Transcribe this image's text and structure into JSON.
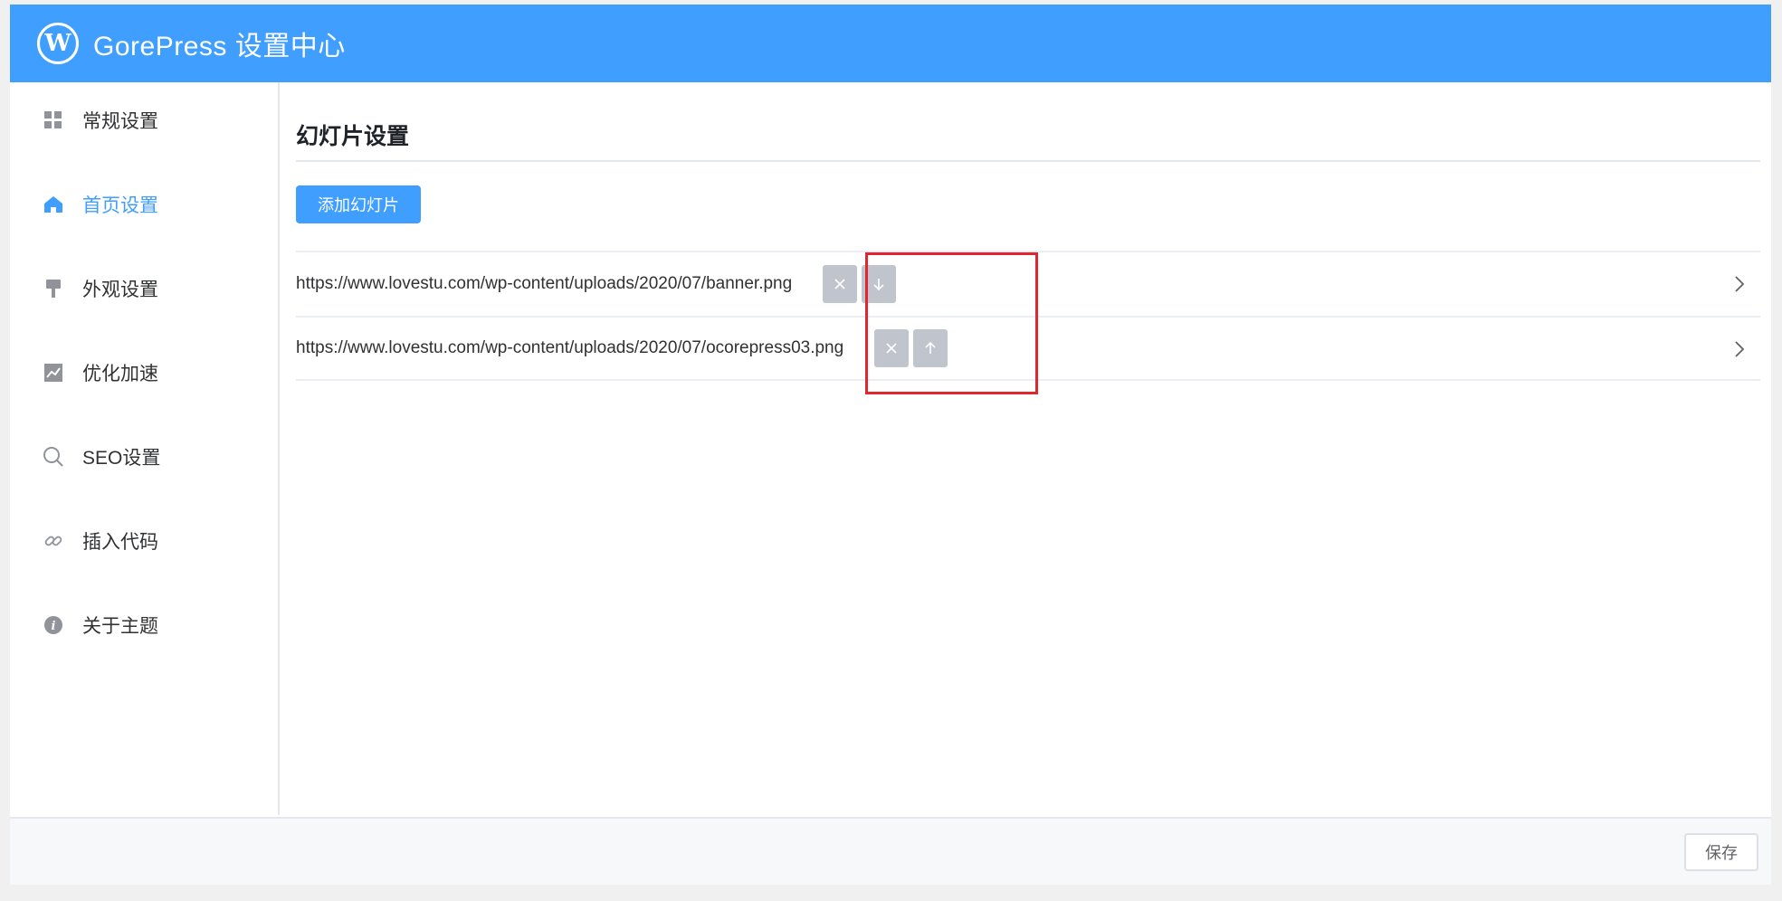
{
  "header": {
    "title": "GorePress 设置中心",
    "logo_icon": "wordpress-logo-icon"
  },
  "sidebar": {
    "items": [
      {
        "label": "常规设置",
        "icon": "grid-icon"
      },
      {
        "label": "首页设置",
        "icon": "home-icon",
        "active": true
      },
      {
        "label": "外观设置",
        "icon": "paint-brush-icon"
      },
      {
        "label": "优化加速",
        "icon": "chart-icon"
      },
      {
        "label": "SEO设置",
        "icon": "search-icon"
      },
      {
        "label": "插入代码",
        "icon": "link-icon"
      },
      {
        "label": "关于主题",
        "icon": "info-icon"
      }
    ]
  },
  "main": {
    "section_title": "幻灯片设置",
    "add_button": "添加幻灯片",
    "slides": [
      {
        "url": "https://www.lovestu.com/wp-content/uploads/2020/07/banner.png",
        "actions": [
          "delete",
          "move-down"
        ]
      },
      {
        "url": "https://www.lovestu.com/wp-content/uploads/2020/07/ocorepress03.png",
        "actions": [
          "delete",
          "move-up"
        ]
      }
    ]
  },
  "footer": {
    "save_label": "保存"
  },
  "colors": {
    "primary": "#409eff",
    "action_gray": "#c0c4cc",
    "highlight_red": "#e0262e"
  }
}
